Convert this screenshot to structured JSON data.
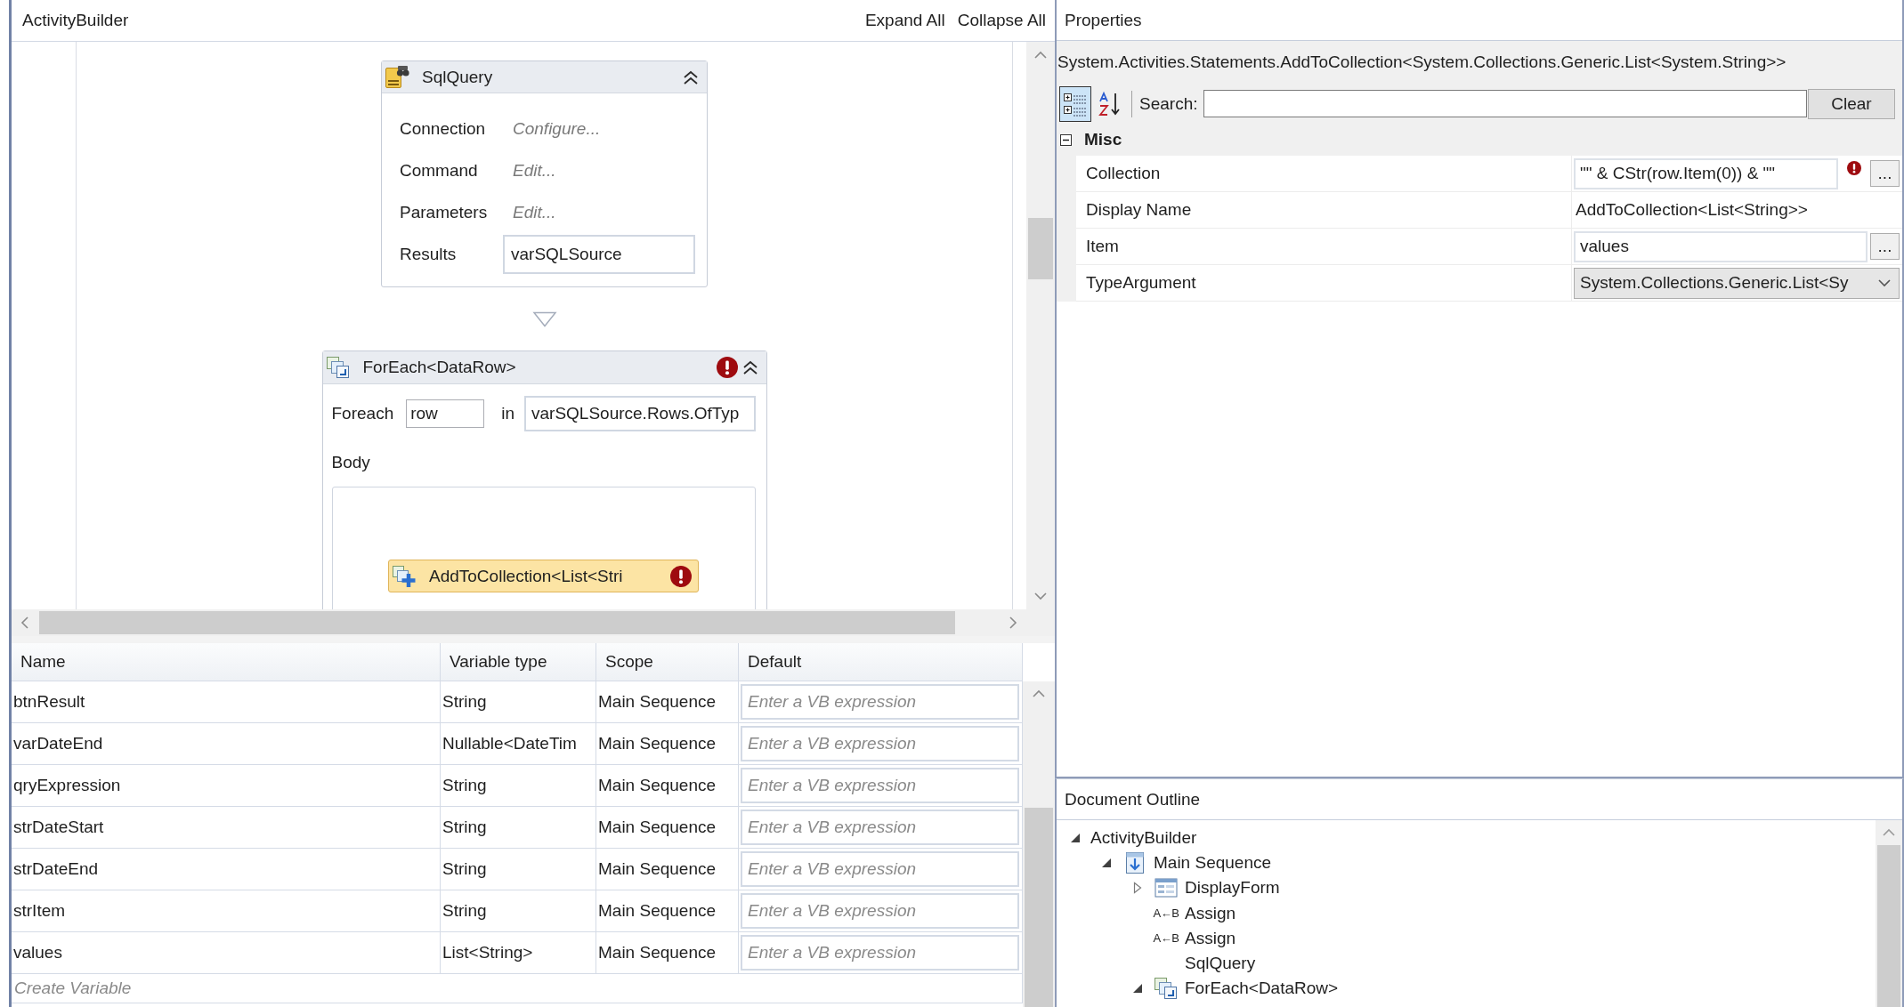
{
  "designer": {
    "breadcrumb": "ActivityBuilder",
    "actions": [
      "Expand All",
      "Collapse All"
    ],
    "activities": [
      {
        "kind": "sql_query",
        "title": "SqlQuery",
        "expanded": true,
        "error": false,
        "fields": [
          {
            "label": "Connection",
            "value": "Configure...",
            "kind": "link"
          },
          {
            "label": "Command",
            "value": "Edit...",
            "kind": "link"
          },
          {
            "label": "Parameters",
            "value": "Edit...",
            "kind": "link"
          },
          {
            "label": "Results",
            "value": "varSQLSource",
            "kind": "input"
          }
        ]
      },
      {
        "kind": "for_each",
        "title": "ForEach<DataRow>",
        "expanded": true,
        "error": true,
        "foreach_label": "Foreach",
        "variable": "row",
        "in_label": "in",
        "values": "varSQLSource.Rows.OfTyp",
        "body_label": "Body",
        "body": [
          {
            "title": "AddToCollection<List<Stri",
            "selected": true,
            "error": true
          }
        ]
      }
    ]
  },
  "variables": {
    "columns": [
      "Name",
      "Variable type",
      "Scope",
      "Default"
    ],
    "rows": [
      {
        "name": "btnResult",
        "type": "String",
        "scope": "Main Sequence",
        "default": {
          "placeholder": "Enter a VB expression"
        }
      },
      {
        "name": "varDateEnd",
        "type": "Nullable<DateTim",
        "scope": "Main Sequence",
        "default": {
          "placeholder": "Enter a VB expression"
        }
      },
      {
        "name": "qryExpression",
        "type": "String",
        "scope": "Main Sequence",
        "default": {
          "placeholder": "Enter a VB expression"
        }
      },
      {
        "name": "strDateStart",
        "type": "String",
        "scope": "Main Sequence",
        "default": {
          "placeholder": "Enter a VB expression"
        }
      },
      {
        "name": "strDateEnd",
        "type": "String",
        "scope": "Main Sequence",
        "default": {
          "placeholder": "Enter a VB expression"
        }
      },
      {
        "name": "strItem",
        "type": "String",
        "scope": "Main Sequence",
        "default": {
          "placeholder": "Enter a VB expression"
        }
      },
      {
        "name": "values",
        "type": "List<String>",
        "scope": "Main Sequence",
        "default": {
          "placeholder": "Enter a VB expression"
        }
      }
    ],
    "create_prompt": "Create Variable"
  },
  "properties": {
    "title": "Properties",
    "object_type": "System.Activities.Statements.AddToCollection<System.Collections.Generic.List<System.String>>",
    "view_buttons": [
      {
        "kind": "categorized",
        "selected": true
      },
      {
        "kind": "alphabetical",
        "selected": false
      }
    ],
    "search_label": "Search:",
    "clear_button": "Clear",
    "categories": [
      {
        "name": "Misc",
        "expanded": true,
        "rows": [
          {
            "name": "Collection",
            "kind": "expression",
            "value": "\"\" & CStr(row.Item(0)) & \"\"",
            "error": true,
            "browse_button": "..."
          },
          {
            "name": "Display Name",
            "kind": "text",
            "value": "AddToCollection<List<String>>",
            "error": false
          },
          {
            "name": "Item",
            "kind": "expression",
            "value": "values",
            "error": false,
            "browse_button": "..."
          },
          {
            "name": "TypeArgument",
            "kind": "dropdown",
            "value": "System.Collections.Generic.List<Sy",
            "error": false
          }
        ]
      }
    ]
  },
  "document_outline": {
    "title": "Document Outline",
    "tree": [
      {
        "label": "ActivityBuilder",
        "kind": "root",
        "expandable": true,
        "expanded": true,
        "children": [
          {
            "label": "Main Sequence",
            "kind": "sequence",
            "expandable": true,
            "expanded": true,
            "children": [
              {
                "label": "DisplayForm",
                "kind": "form",
                "expandable": true,
                "expanded": false
              },
              {
                "label": "Assign",
                "kind": "assign",
                "icon_text": "A←B",
                "expandable": false
              },
              {
                "label": "Assign",
                "kind": "assign",
                "icon_text": "A←B",
                "expandable": false
              },
              {
                "label": "SqlQuery",
                "kind": "activity",
                "expandable": false
              },
              {
                "label": "ForEach<DataRow>",
                "kind": "for_each",
                "expandable": true,
                "expanded": true
              }
            ]
          }
        ]
      }
    ]
  }
}
